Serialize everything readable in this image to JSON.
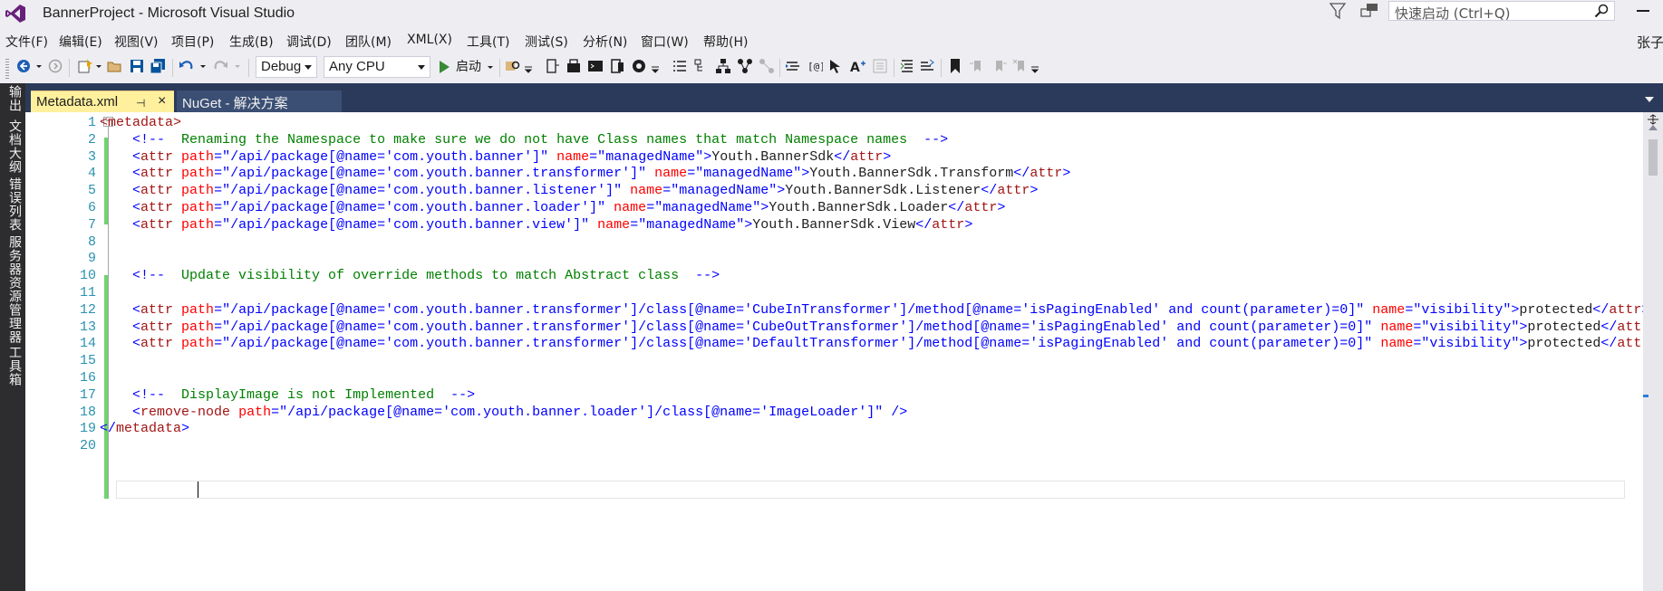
{
  "window": {
    "title": "BannerProject - Microsoft Visual Studio"
  },
  "quick_launch": {
    "placeholder": "快速启动 (Ctrl+Q)"
  },
  "menu": [
    "文件(F)",
    "编辑(E)",
    "视图(V)",
    "项目(P)",
    "生成(B)",
    "调试(D)",
    "团队(M)",
    "XML(X)",
    "工具(T)",
    "测试(S)",
    "分析(N)",
    "窗口(W)",
    "帮助(H)"
  ],
  "user": {
    "name": "张子"
  },
  "toolbar": {
    "configuration": "Debug",
    "platform": "Any CPU",
    "start_label": "启动"
  },
  "left_rail": [
    "输出",
    "文档大纲",
    "错误列表",
    "服务器资源管理器",
    "工具箱"
  ],
  "tabs": [
    {
      "label": "Metadata.xml",
      "active": true
    },
    {
      "label": "NuGet - 解决方案",
      "active": false
    }
  ],
  "editor": {
    "line_numbers": [
      "1",
      "2",
      "3",
      "4",
      "5",
      "6",
      "7",
      "8",
      "9",
      "10",
      "11",
      "12",
      "13",
      "14",
      "15",
      "16",
      "17",
      "18",
      "19",
      "20"
    ],
    "lines": [
      [
        {
          "t": "tag",
          "v": "<metadata>"
        }
      ],
      [
        {
          "t": "text",
          "v": "  "
        },
        {
          "t": "delim",
          "v": "<!--"
        },
        {
          "t": "comment",
          "v": "  Renaming the Namespace to make sure we do not have Class names that match Namespace names  "
        },
        {
          "t": "delim",
          "v": "-->"
        }
      ],
      [
        {
          "t": "text",
          "v": "  "
        },
        {
          "t": "delim",
          "v": "<"
        },
        {
          "t": "tag",
          "v": "attr"
        },
        {
          "t": "attr",
          "v": " path"
        },
        {
          "t": "delim",
          "v": "=\""
        },
        {
          "t": "val",
          "v": "/api/package[@name='com.youth.banner']"
        },
        {
          "t": "delim",
          "v": "\""
        },
        {
          "t": "attr",
          "v": " name"
        },
        {
          "t": "delim",
          "v": "=\""
        },
        {
          "t": "val",
          "v": "managedName"
        },
        {
          "t": "delim",
          "v": "\">"
        },
        {
          "t": "text",
          "v": "Youth.BannerSdk"
        },
        {
          "t": "delim",
          "v": "</"
        },
        {
          "t": "tag",
          "v": "attr"
        },
        {
          "t": "delim",
          "v": ">"
        }
      ],
      [
        {
          "t": "text",
          "v": "  "
        },
        {
          "t": "delim",
          "v": "<"
        },
        {
          "t": "tag",
          "v": "attr"
        },
        {
          "t": "attr",
          "v": " path"
        },
        {
          "t": "delim",
          "v": "=\""
        },
        {
          "t": "val",
          "v": "/api/package[@name='com.youth.banner.transformer']"
        },
        {
          "t": "delim",
          "v": "\""
        },
        {
          "t": "attr",
          "v": " name"
        },
        {
          "t": "delim",
          "v": "=\""
        },
        {
          "t": "val",
          "v": "managedName"
        },
        {
          "t": "delim",
          "v": "\">"
        },
        {
          "t": "text",
          "v": "Youth.BannerSdk.Transform"
        },
        {
          "t": "delim",
          "v": "</"
        },
        {
          "t": "tag",
          "v": "attr"
        },
        {
          "t": "delim",
          "v": ">"
        }
      ],
      [
        {
          "t": "text",
          "v": "  "
        },
        {
          "t": "delim",
          "v": "<"
        },
        {
          "t": "tag",
          "v": "attr"
        },
        {
          "t": "attr",
          "v": " path"
        },
        {
          "t": "delim",
          "v": "=\""
        },
        {
          "t": "val",
          "v": "/api/package[@name='com.youth.banner.listener']"
        },
        {
          "t": "delim",
          "v": "\""
        },
        {
          "t": "attr",
          "v": " name"
        },
        {
          "t": "delim",
          "v": "=\""
        },
        {
          "t": "val",
          "v": "managedName"
        },
        {
          "t": "delim",
          "v": "\">"
        },
        {
          "t": "text",
          "v": "Youth.BannerSdk.Listener"
        },
        {
          "t": "delim",
          "v": "</"
        },
        {
          "t": "tag",
          "v": "attr"
        },
        {
          "t": "delim",
          "v": ">"
        }
      ],
      [
        {
          "t": "text",
          "v": "  "
        },
        {
          "t": "delim",
          "v": "<"
        },
        {
          "t": "tag",
          "v": "attr"
        },
        {
          "t": "attr",
          "v": " path"
        },
        {
          "t": "delim",
          "v": "=\""
        },
        {
          "t": "val",
          "v": "/api/package[@name='com.youth.banner.loader']"
        },
        {
          "t": "delim",
          "v": "\""
        },
        {
          "t": "attr",
          "v": " name"
        },
        {
          "t": "delim",
          "v": "=\""
        },
        {
          "t": "val",
          "v": "managedName"
        },
        {
          "t": "delim",
          "v": "\">"
        },
        {
          "t": "text",
          "v": "Youth.BannerSdk.Loader"
        },
        {
          "t": "delim",
          "v": "</"
        },
        {
          "t": "tag",
          "v": "attr"
        },
        {
          "t": "delim",
          "v": ">"
        }
      ],
      [
        {
          "t": "text",
          "v": "  "
        },
        {
          "t": "delim",
          "v": "<"
        },
        {
          "t": "tag",
          "v": "attr"
        },
        {
          "t": "attr",
          "v": " path"
        },
        {
          "t": "delim",
          "v": "=\""
        },
        {
          "t": "val",
          "v": "/api/package[@name='com.youth.banner.view']"
        },
        {
          "t": "delim",
          "v": "\""
        },
        {
          "t": "attr",
          "v": " name"
        },
        {
          "t": "delim",
          "v": "=\""
        },
        {
          "t": "val",
          "v": "managedName"
        },
        {
          "t": "delim",
          "v": "\">"
        },
        {
          "t": "text",
          "v": "Youth.BannerSdk.View"
        },
        {
          "t": "delim",
          "v": "</"
        },
        {
          "t": "tag",
          "v": "attr"
        },
        {
          "t": "delim",
          "v": ">"
        }
      ],
      [],
      [],
      [
        {
          "t": "text",
          "v": "  "
        },
        {
          "t": "delim",
          "v": "<!--"
        },
        {
          "t": "comment",
          "v": "  Update visibility of override methods to match Abstract class  "
        },
        {
          "t": "delim",
          "v": "-->"
        }
      ],
      [],
      [
        {
          "t": "text",
          "v": "  "
        },
        {
          "t": "delim",
          "v": "<"
        },
        {
          "t": "tag",
          "v": "attr"
        },
        {
          "t": "attr",
          "v": " path"
        },
        {
          "t": "delim",
          "v": "=\""
        },
        {
          "t": "val",
          "v": "/api/package[@name='com.youth.banner.transformer']/class[@name='CubeInTransformer']/method[@name='isPagingEnabled' and count(parameter)=0]"
        },
        {
          "t": "delim",
          "v": "\""
        },
        {
          "t": "attr",
          "v": " name"
        },
        {
          "t": "delim",
          "v": "=\""
        },
        {
          "t": "val",
          "v": "visibility"
        },
        {
          "t": "delim",
          "v": "\">"
        },
        {
          "t": "text",
          "v": "protected"
        },
        {
          "t": "delim",
          "v": "</"
        },
        {
          "t": "tag",
          "v": "attr"
        },
        {
          "t": "delim",
          "v": ">"
        }
      ],
      [
        {
          "t": "text",
          "v": "  "
        },
        {
          "t": "delim",
          "v": "<"
        },
        {
          "t": "tag",
          "v": "attr"
        },
        {
          "t": "attr",
          "v": " path"
        },
        {
          "t": "delim",
          "v": "=\""
        },
        {
          "t": "val",
          "v": "/api/package[@name='com.youth.banner.transformer']/class[@name='CubeOutTransformer']/method[@name='isPagingEnabled' and count(parameter)=0]"
        },
        {
          "t": "delim",
          "v": "\""
        },
        {
          "t": "attr",
          "v": " name"
        },
        {
          "t": "delim",
          "v": "=\""
        },
        {
          "t": "val",
          "v": "visibility"
        },
        {
          "t": "delim",
          "v": "\">"
        },
        {
          "t": "text",
          "v": "protected"
        },
        {
          "t": "delim",
          "v": "</"
        },
        {
          "t": "tag",
          "v": "attr"
        },
        {
          "t": "delim",
          "v": ">"
        }
      ],
      [
        {
          "t": "text",
          "v": "  "
        },
        {
          "t": "delim",
          "v": "<"
        },
        {
          "t": "tag",
          "v": "attr"
        },
        {
          "t": "attr",
          "v": " path"
        },
        {
          "t": "delim",
          "v": "=\""
        },
        {
          "t": "val",
          "v": "/api/package[@name='com.youth.banner.transformer']/class[@name='DefaultTransformer']/method[@name='isPagingEnabled' and count(parameter)=0]"
        },
        {
          "t": "delim",
          "v": "\""
        },
        {
          "t": "attr",
          "v": " name"
        },
        {
          "t": "delim",
          "v": "=\""
        },
        {
          "t": "val",
          "v": "visibility"
        },
        {
          "t": "delim",
          "v": "\">"
        },
        {
          "t": "text",
          "v": "protected"
        },
        {
          "t": "delim",
          "v": "</"
        },
        {
          "t": "tag",
          "v": "attr"
        },
        {
          "t": "delim",
          "v": ">"
        }
      ],
      [],
      [],
      [
        {
          "t": "text",
          "v": "  "
        },
        {
          "t": "delim",
          "v": "<!--"
        },
        {
          "t": "comment",
          "v": "  DisplayImage is not Implemented  "
        },
        {
          "t": "delim",
          "v": "-->"
        }
      ],
      [
        {
          "t": "text",
          "v": "  "
        },
        {
          "t": "delim",
          "v": "<"
        },
        {
          "t": "tag",
          "v": "remove-node"
        },
        {
          "t": "attr",
          "v": " path"
        },
        {
          "t": "delim",
          "v": "=\""
        },
        {
          "t": "val",
          "v": "/api/package[@name='com.youth.banner.loader']/class[@name='ImageLoader']"
        },
        {
          "t": "delim",
          "v": "\""
        },
        {
          "t": "delim",
          "v": " />"
        }
      ],
      [
        {
          "t": "delim",
          "v": "</"
        },
        {
          "t": "tag",
          "v": "metadata"
        },
        {
          "t": "delim",
          "v": ">"
        }
      ],
      []
    ]
  },
  "colors": {
    "tab_active": "#fff09e",
    "tabstrip": "#2b3a5a",
    "line_number": "#2b91af",
    "change_bar": "#6fd36f"
  }
}
